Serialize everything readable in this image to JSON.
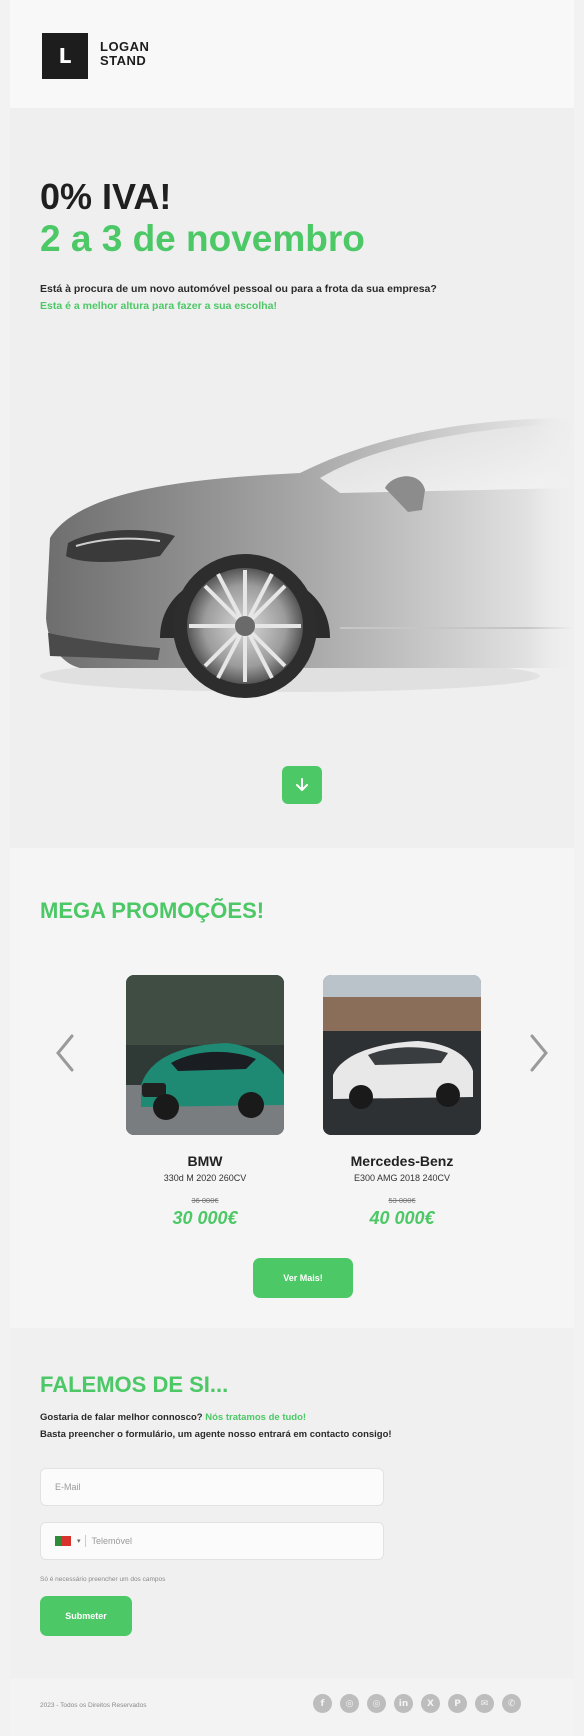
{
  "header": {
    "logo_letter": "L",
    "logo_line1": "LOGAN",
    "logo_line2": "STAND"
  },
  "hero": {
    "title": "0% IVA!",
    "subtitle": "2 a 3 de novembro",
    "text": "Está à procura de um novo automóvel pessoal ou para a frota da sua empresa?",
    "highlight": "Esta é a melhor altura para fazer a sua escolha!",
    "scroll_icon": "arrow-down-icon"
  },
  "promos": {
    "title": "MEGA PROMOÇÕES!",
    "cars": [
      {
        "name": "BMW",
        "model": "330d M 2020 260CV",
        "old_price": "36 000€",
        "price": "30 000€"
      },
      {
        "name": "Mercedes-Benz",
        "model": "E300 AMG 2018 240CV",
        "old_price": "53 000€",
        "price": "40 000€"
      }
    ],
    "more_label": "Ver Mais!"
  },
  "contact": {
    "title": "FALEMOS DE SI...",
    "line1": "Gostaria de falar melhor connosco?",
    "line1_highlight": "Nós tratamos de tudo!",
    "line2": "Basta preencher o formulário, um agente nosso entrará em contacto consigo!",
    "email_placeholder": "E-Mail",
    "phone_placeholder": "Telemóvel",
    "phone_country_caret": "▾",
    "note": "Só é necessário preencher um dos campos",
    "submit_label": "Submeter"
  },
  "footer": {
    "copyright": "2023 - Todos os Direitos Reservados",
    "socials": [
      "facebook-icon",
      "instagram-icon",
      "instagram-icon",
      "linkedin-icon",
      "x-icon",
      "pinterest-icon",
      "messenger-icon",
      "whatsapp-icon"
    ]
  },
  "colors": {
    "accent": "#4cc866",
    "dark": "#1d1d1d",
    "background": "#f2f2f2"
  }
}
